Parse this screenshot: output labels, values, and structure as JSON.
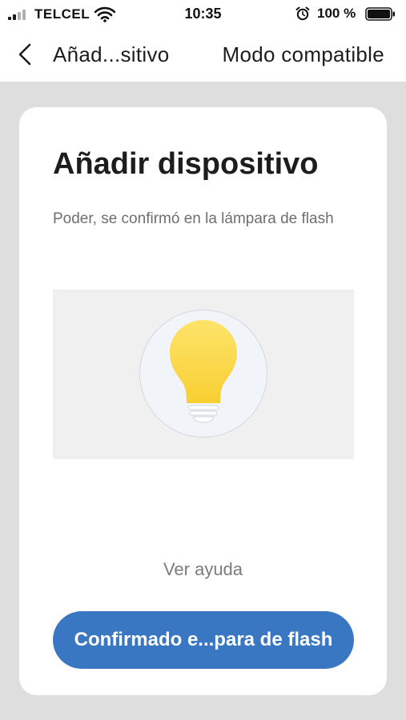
{
  "status_bar": {
    "carrier": "TELCEL",
    "time": "10:35",
    "battery_percent": "100 %",
    "icons": [
      "signal-icon",
      "wifi-icon",
      "alarm-icon",
      "battery-icon"
    ]
  },
  "nav": {
    "back_icon": "chevron-left-icon",
    "title": "Añad...sitivo",
    "action_label": "Modo compatible"
  },
  "card": {
    "title": "Añadir dispositivo",
    "description": "Poder, se confirmó en la lámpara de flash",
    "illustration_icon": "light-bulb-icon",
    "help_link": "Ver ayuda",
    "confirm_button": "Confirmado e...para de flash"
  },
  "colors": {
    "accent": "#3a77c3",
    "bulb": "#fbdc4e",
    "background": "#dedede"
  }
}
